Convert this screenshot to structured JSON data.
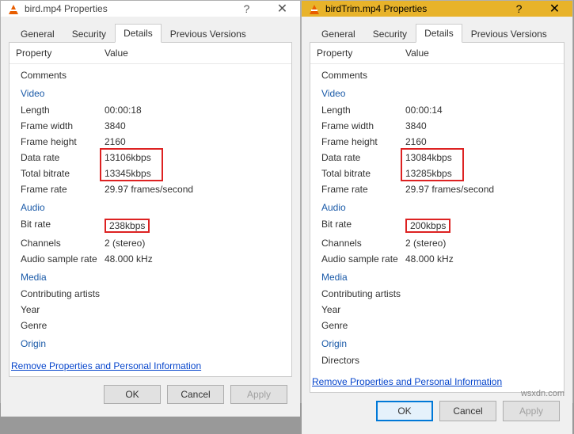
{
  "watermark": "wsxdn.com",
  "left": {
    "title": "bird.mp4 Properties",
    "tabs": [
      "General",
      "Security",
      "Details",
      "Previous Versions"
    ],
    "activeTab": 2,
    "headers": {
      "property": "Property",
      "value": "Value"
    },
    "sections": {
      "video": "Video",
      "audio": "Audio",
      "media": "Media",
      "origin": "Origin"
    },
    "rows": {
      "comments_label": "Comments",
      "length_label": "Length",
      "length": "00:00:18",
      "frame_width_label": "Frame width",
      "frame_width": "3840",
      "frame_height_label": "Frame height",
      "frame_height": "2160",
      "data_rate_label": "Data rate",
      "data_rate": "13106kbps",
      "total_bitrate_label": "Total bitrate",
      "total_bitrate": "13345kbps",
      "frame_rate_label": "Frame rate",
      "frame_rate": "29.97 frames/second",
      "bit_rate_label": "Bit rate",
      "bit_rate": "238kbps",
      "channels_label": "Channels",
      "channels": "2 (stereo)",
      "sample_rate_label": "Audio sample rate",
      "sample_rate": "48.000 kHz",
      "contributing_label": "Contributing artists",
      "year_label": "Year",
      "genre_label": "Genre"
    },
    "link": "Remove Properties and Personal Information",
    "buttons": {
      "ok": "OK",
      "cancel": "Cancel",
      "apply": "Apply"
    }
  },
  "right": {
    "title": "birdTrim.mp4 Properties",
    "tabs": [
      "General",
      "Security",
      "Details",
      "Previous Versions"
    ],
    "activeTab": 2,
    "headers": {
      "property": "Property",
      "value": "Value"
    },
    "sections": {
      "video": "Video",
      "audio": "Audio",
      "media": "Media",
      "origin": "Origin"
    },
    "rows": {
      "comments_label": "Comments",
      "length_label": "Length",
      "length": "00:00:14",
      "frame_width_label": "Frame width",
      "frame_width": "3840",
      "frame_height_label": "Frame height",
      "frame_height": "2160",
      "data_rate_label": "Data rate",
      "data_rate": "13084kbps",
      "total_bitrate_label": "Total bitrate",
      "total_bitrate": "13285kbps",
      "frame_rate_label": "Frame rate",
      "frame_rate": "29.97 frames/second",
      "bit_rate_label": "Bit rate",
      "bit_rate": "200kbps",
      "channels_label": "Channels",
      "channels": "2 (stereo)",
      "sample_rate_label": "Audio sample rate",
      "sample_rate": "48.000 kHz",
      "contributing_label": "Contributing artists",
      "year_label": "Year",
      "genre_label": "Genre",
      "directors_label": "Directors"
    },
    "link": "Remove Properties and Personal Information",
    "buttons": {
      "ok": "OK",
      "cancel": "Cancel",
      "apply": "Apply"
    }
  }
}
